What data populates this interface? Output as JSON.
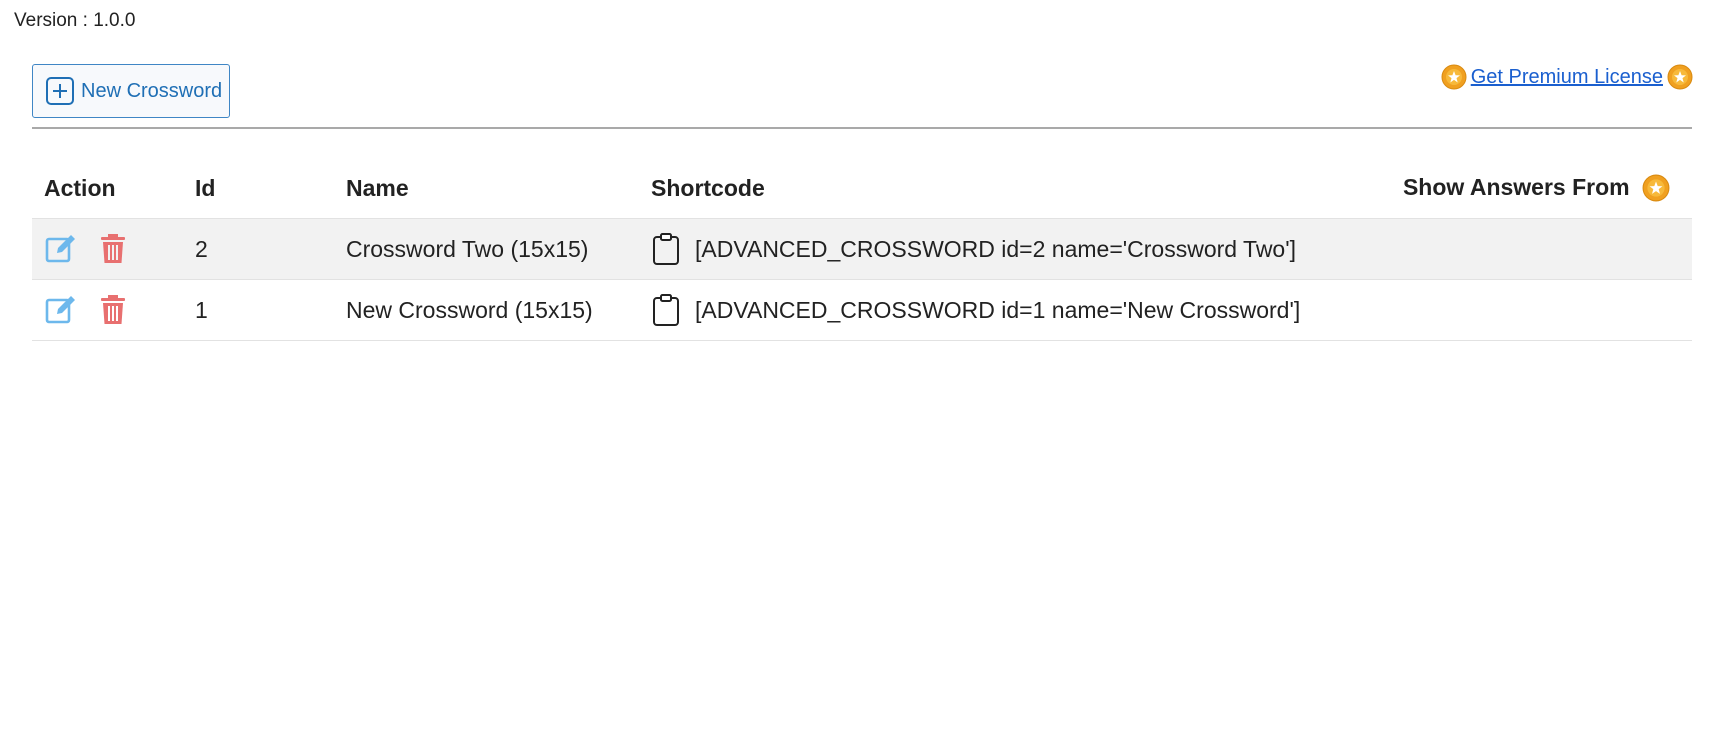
{
  "version_text": "Version : 1.0.0",
  "toolbar": {
    "new_crossword_label": "New Crossword",
    "premium_link_label": "Get Premium License "
  },
  "table": {
    "headers": {
      "action": "Action",
      "id": "Id",
      "name": "Name",
      "shortcode": "Shortcode",
      "show_answers": "Show Answers From"
    },
    "rows": [
      {
        "id": "2",
        "name": "Crossword Two (15x15)",
        "shortcode": "[ADVANCED_CROSSWORD id=2 name='Crossword Two']",
        "show_answers": ""
      },
      {
        "id": "1",
        "name": "New Crossword (15x15)",
        "shortcode": "[ADVANCED_CROSSWORD id=1 name='New Crossword']",
        "show_answers": ""
      }
    ]
  },
  "icons": {
    "plus": "plus-square-icon",
    "coin": "premium-coin-icon",
    "edit": "edit-icon",
    "delete": "trash-icon",
    "copy": "clipboard-icon"
  },
  "colors": {
    "link": "#1a5fcf",
    "button_text": "#1f6fb5",
    "edit_icon": "#6db8ec",
    "delete_icon": "#e87070",
    "coin": "#f0a020",
    "row_shade": "#f2f2f2"
  }
}
